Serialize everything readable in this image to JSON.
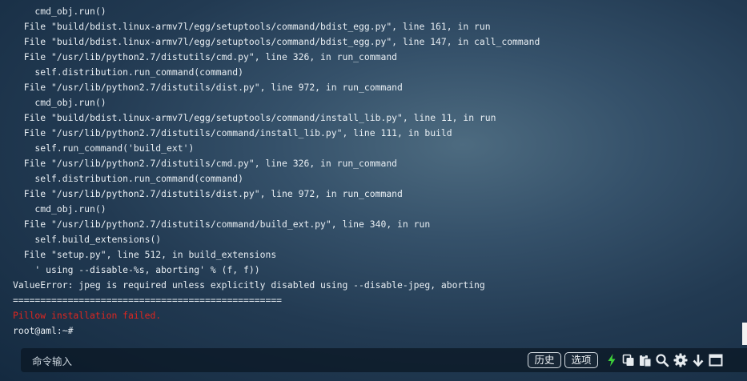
{
  "terminal": {
    "lines": [
      "    cmd_obj.run()",
      "  File \"build/bdist.linux-armv7l/egg/setuptools/command/bdist_egg.py\", line 161, in run",
      "  File \"build/bdist.linux-armv7l/egg/setuptools/command/bdist_egg.py\", line 147, in call_command",
      "  File \"/usr/lib/python2.7/distutils/cmd.py\", line 326, in run_command",
      "    self.distribution.run_command(command)",
      "  File \"/usr/lib/python2.7/distutils/dist.py\", line 972, in run_command",
      "    cmd_obj.run()",
      "  File \"build/bdist.linux-armv7l/egg/setuptools/command/install_lib.py\", line 11, in run",
      "  File \"/usr/lib/python2.7/distutils/command/install_lib.py\", line 111, in build",
      "    self.run_command('build_ext')",
      "  File \"/usr/lib/python2.7/distutils/cmd.py\", line 326, in run_command",
      "    self.distribution.run_command(command)",
      "  File \"/usr/lib/python2.7/distutils/dist.py\", line 972, in run_command",
      "    cmd_obj.run()",
      "  File \"/usr/lib/python2.7/distutils/command/build_ext.py\", line 340, in run",
      "    self.build_extensions()",
      "  File \"setup.py\", line 512, in build_extensions",
      "    ' using --disable-%s, aborting' % (f, f))",
      "ValueError: jpeg is required unless explicitly disabled using --disable-jpeg, aborting",
      "=================================================",
      "Pillow installation failed.",
      "root@aml:~#"
    ],
    "error_line_index": 20,
    "colors": {
      "text": "#e8eef3",
      "error": "#e0261f"
    }
  },
  "command_bar": {
    "placeholder": "命令输入",
    "history_label": "历史",
    "options_label": "选项",
    "icons": [
      "lightning-icon",
      "copy-icon",
      "paste-icon",
      "search-icon",
      "gear-icon",
      "arrow-down-icon",
      "window-icon"
    ],
    "accent_color": "#3fd23a"
  }
}
